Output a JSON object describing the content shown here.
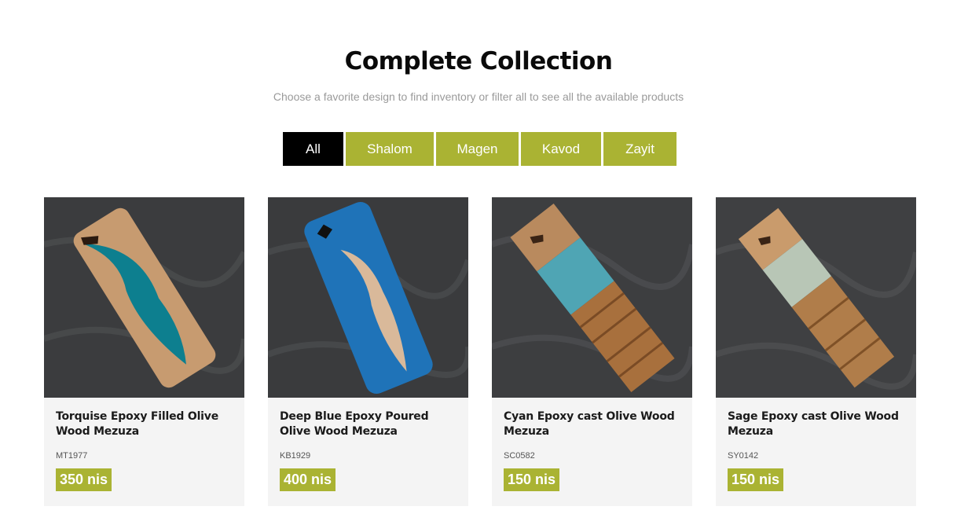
{
  "header": {
    "title": "Complete Collection",
    "subtitle": "Choose a favorite design to find inventory or filter all to see all the available products"
  },
  "filters": [
    {
      "label": "All",
      "active": true
    },
    {
      "label": "Shalom",
      "active": false
    },
    {
      "label": "Magen",
      "active": false
    },
    {
      "label": "Kavod",
      "active": false
    },
    {
      "label": "Zayit",
      "active": false
    }
  ],
  "colors": {
    "accent": "#aab333",
    "active_filter": "#000000",
    "card_bg": "#f4f4f4"
  },
  "products": [
    {
      "title": "Torquise Epoxy Filled Olive Wood Mezuza",
      "sku": "MT1977",
      "price": "350 nis"
    },
    {
      "title": "Deep Blue Epoxy Poured Olive Wood Mezuza",
      "sku": "KB1929",
      "price": "400 nis"
    },
    {
      "title": "Cyan Epoxy cast Olive Wood Mezuza",
      "sku": "SC0582",
      "price": "150 nis"
    },
    {
      "title": "Sage Epoxy cast Olive Wood Mezuza",
      "sku": "SY0142",
      "price": "150 nis"
    }
  ]
}
